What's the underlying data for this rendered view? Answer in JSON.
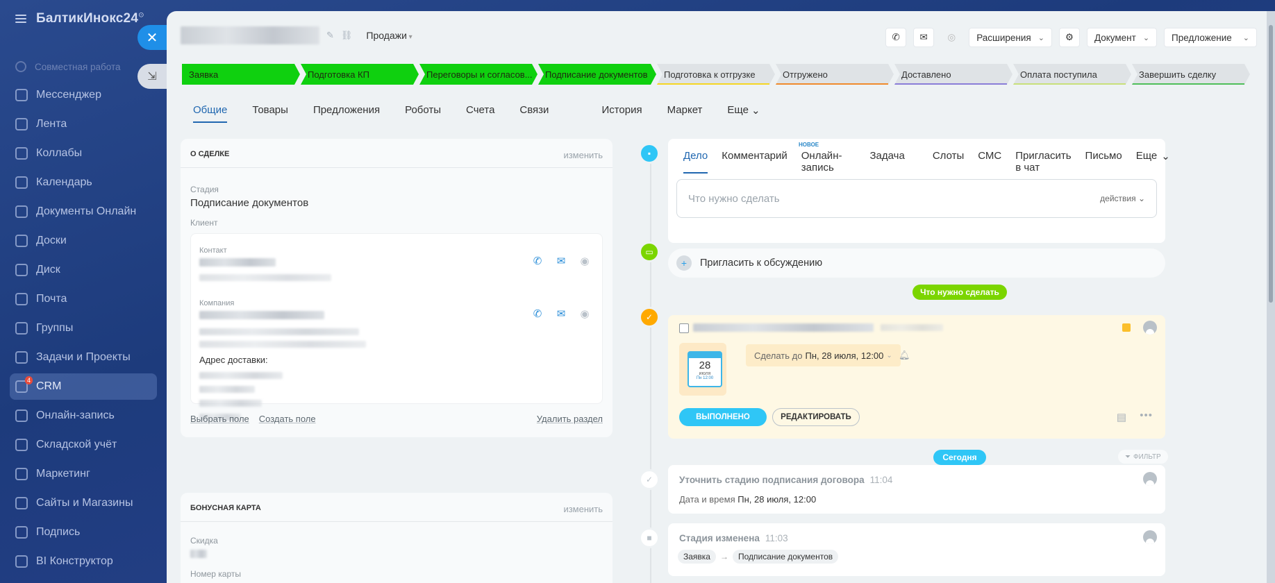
{
  "nav": {
    "logo": "БалтикИнокс24",
    "items": [
      {
        "label": "Совместная работа",
        "icon": "collab-icon"
      },
      {
        "label": "Мессенджер",
        "icon": "messenger-icon"
      },
      {
        "label": "Лента",
        "icon": "feed-icon"
      },
      {
        "label": "Коллабы",
        "icon": "collabs-icon"
      },
      {
        "label": "Календарь",
        "icon": "calendar-icon"
      },
      {
        "label": "Документы Онлайн",
        "icon": "documents-icon"
      },
      {
        "label": "Доски",
        "icon": "boards-icon"
      },
      {
        "label": "Диск",
        "icon": "disk-icon"
      },
      {
        "label": "Почта",
        "icon": "mail-icon"
      },
      {
        "label": "Группы",
        "icon": "groups-icon"
      },
      {
        "label": "Задачи и Проекты",
        "icon": "tasks-icon"
      },
      {
        "label": "CRM",
        "icon": "crm-icon",
        "badge": "4"
      },
      {
        "label": "Онлайн-запись",
        "icon": "booking-icon"
      },
      {
        "label": "Складской учёт",
        "icon": "warehouse-icon"
      },
      {
        "label": "Маркетинг",
        "icon": "marketing-icon"
      },
      {
        "label": "Сайты и Магазины",
        "icon": "sites-icon"
      },
      {
        "label": "Подпись",
        "icon": "sign-icon"
      },
      {
        "label": "BI Конструктор",
        "icon": "bi-icon"
      }
    ],
    "top_badge": "4"
  },
  "header": {
    "category": "Продажи",
    "buttons": {
      "extensions": "Расширения",
      "document": "Документ",
      "offer": "Предложение"
    }
  },
  "stages": [
    {
      "label": "Заявка",
      "state": "done",
      "color": "#0fd00f"
    },
    {
      "label": "Подготовка КП",
      "state": "done",
      "color": "#0fd00f"
    },
    {
      "label": "Переговоры и согласов...",
      "state": "done",
      "color": "#0fd00f"
    },
    {
      "label": "Подписание документов",
      "state": "done",
      "color": "#0fd00f"
    },
    {
      "label": "Подготовка к отгрузке",
      "state": "todo",
      "color": "#f5d623"
    },
    {
      "label": "Отгружено",
      "state": "todo",
      "color": "#f08a2c"
    },
    {
      "label": "Доставлено",
      "state": "todo",
      "color": "#8a7dd8"
    },
    {
      "label": "Оплата поступила",
      "state": "todo",
      "color": "#c8e07a"
    },
    {
      "label": "Завершить сделку",
      "state": "todo",
      "color": "#4fbf5a"
    }
  ],
  "tabs": [
    "Общие",
    "Товары",
    "Предложения",
    "Роботы",
    "Счета",
    "Связи",
    "История",
    "Маркет",
    "Еще"
  ],
  "about": {
    "title": "О СДЕЛКЕ",
    "edit": "изменить",
    "stage_label": "Стадия",
    "stage_value": "Подписание документов",
    "client_label": "Клиент",
    "contact_label": "Контакт",
    "company_label": "Компания",
    "delivery_label": "Адрес доставки:",
    "select_field": "Выбрать поле",
    "create_field": "Создать поле",
    "delete_section": "Удалить раздел"
  },
  "bonus": {
    "title": "БОНУСНАЯ КАРТА",
    "edit": "изменить",
    "discount_label": "Скидка",
    "card_label": "Номер карты"
  },
  "activity": {
    "tabs": [
      "Дело",
      "Комментарий",
      "Онлайн-запись",
      "Задача",
      "Слоты",
      "СМС",
      "Пригласить в чат",
      "Письмо",
      "Еще"
    ],
    "new_badge": "НОВОЕ",
    "placeholder": "Что нужно сделать",
    "actions": "действия"
  },
  "invite": "Пригласить к обсуждению",
  "todo_pill": "Что нужно сделать",
  "todo": {
    "deadline_label": "Сделать до",
    "deadline_value": "Пн, 28 июля, 12:00",
    "cal_day": "28",
    "cal_month": "июля",
    "cal_small": "Пн 12:00",
    "done": "ВЫПОЛНЕНО",
    "edit": "РЕДАКТИРОВАТЬ"
  },
  "today_pill": "Сегодня",
  "filter": "ФИЛЬТР",
  "history": [
    {
      "title": "Уточнить стадию подписания договора",
      "time": "11:04",
      "line_label": "Дата и время",
      "line_value": "Пн, 28 июля, 12:00"
    },
    {
      "title": "Стадия изменена",
      "time": "11:03",
      "from": "Заявка",
      "to": "Подписание документов"
    }
  ]
}
